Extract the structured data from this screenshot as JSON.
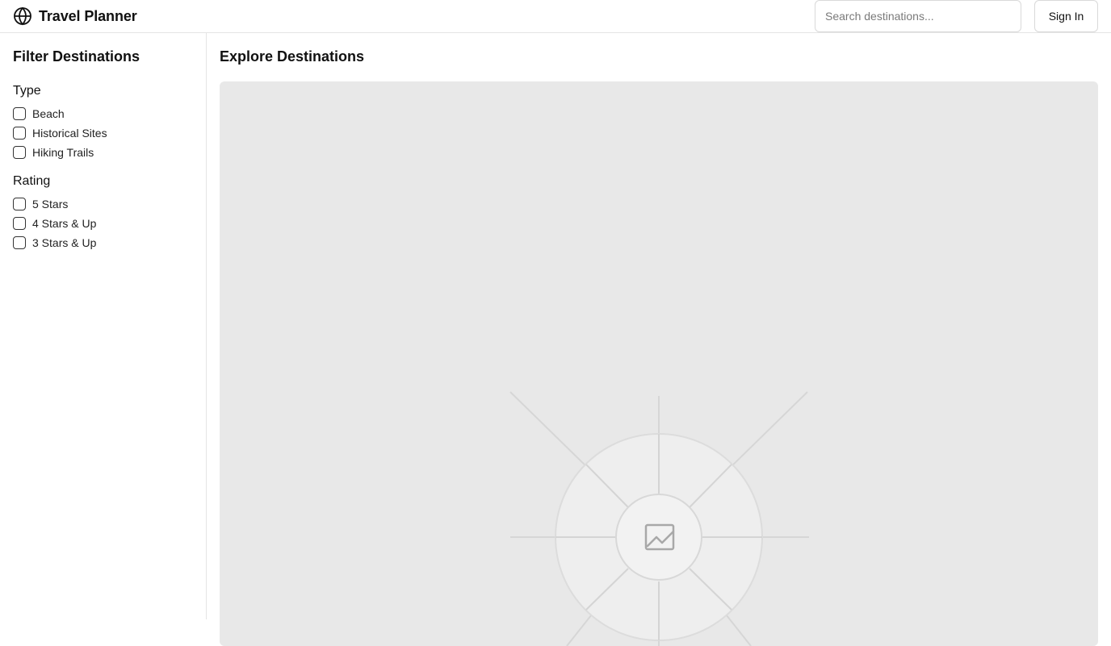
{
  "header": {
    "brand_icon": "globe-icon",
    "title": "Travel Planner",
    "search_placeholder": "Search destinations...",
    "search_value": "",
    "sign_in_label": "Sign In"
  },
  "sidebar": {
    "title": "Filter Destinations",
    "groups": [
      {
        "title": "Type",
        "options": [
          {
            "label": "Beach",
            "checked": false
          },
          {
            "label": "Historical Sites",
            "checked": false
          },
          {
            "label": "Hiking Trails",
            "checked": false
          }
        ]
      },
      {
        "title": "Rating",
        "options": [
          {
            "label": "5 Stars",
            "checked": false
          },
          {
            "label": "4 Stars & Up",
            "checked": false
          },
          {
            "label": "3 Stars & Up",
            "checked": false
          }
        ]
      }
    ]
  },
  "main": {
    "title": "Explore Destinations",
    "image_icon": "image-icon"
  },
  "colors": {
    "border": "#e5e5e5",
    "placeholder_bg": "#e8e8e8",
    "text": "#111111"
  }
}
